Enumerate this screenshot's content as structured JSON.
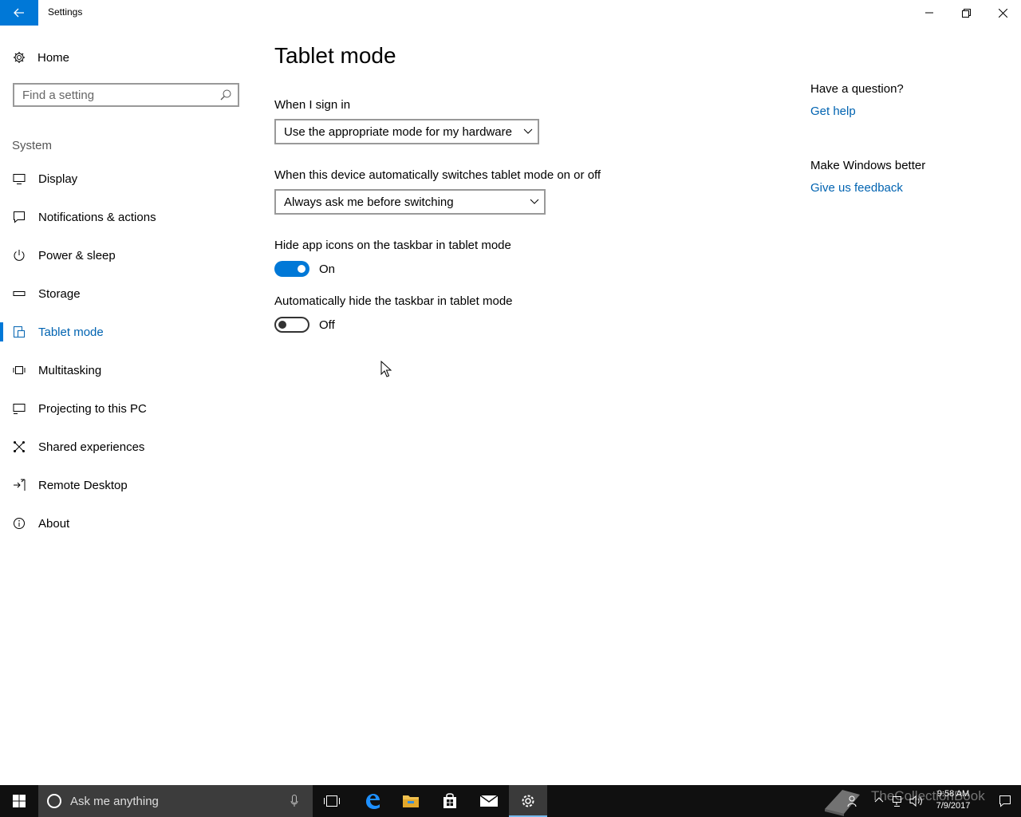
{
  "window": {
    "title": "Settings"
  },
  "sidebar": {
    "home_label": "Home",
    "search_placeholder": "Find a setting",
    "section_label": "System",
    "items": [
      {
        "label": "Display",
        "icon": "display-icon"
      },
      {
        "label": "Notifications & actions",
        "icon": "notifications-icon"
      },
      {
        "label": "Power & sleep",
        "icon": "power-icon"
      },
      {
        "label": "Storage",
        "icon": "storage-icon"
      },
      {
        "label": "Tablet mode",
        "icon": "tablet-mode-icon",
        "active": true
      },
      {
        "label": "Multitasking",
        "icon": "multitasking-icon"
      },
      {
        "label": "Projecting to this PC",
        "icon": "projecting-icon"
      },
      {
        "label": "Shared experiences",
        "icon": "shared-experiences-icon"
      },
      {
        "label": "Remote Desktop",
        "icon": "remote-desktop-icon"
      },
      {
        "label": "About",
        "icon": "info-icon"
      }
    ]
  },
  "main": {
    "title": "Tablet mode",
    "sign_in": {
      "label": "When I sign in",
      "value": "Use the appropriate mode for my hardware"
    },
    "auto_switch": {
      "label": "When this device automatically switches tablet mode on or off",
      "value": "Always ask me before switching"
    },
    "hide_icons": {
      "label": "Hide app icons on the taskbar in tablet mode",
      "state": "On"
    },
    "hide_taskbar": {
      "label": "Automatically hide the taskbar in tablet mode",
      "state": "Off"
    }
  },
  "aside": {
    "question": "Have a question?",
    "help_link": "Get help",
    "better": "Make Windows better",
    "feedback_link": "Give us feedback"
  },
  "taskbar": {
    "search_placeholder": "Ask me anything",
    "time": "9:58 AM",
    "date": "7/9/2017",
    "watermark": "TheCollectionBook"
  },
  "colors": {
    "accent": "#0078d7",
    "link": "#0063b1",
    "taskbar": "#101010"
  }
}
